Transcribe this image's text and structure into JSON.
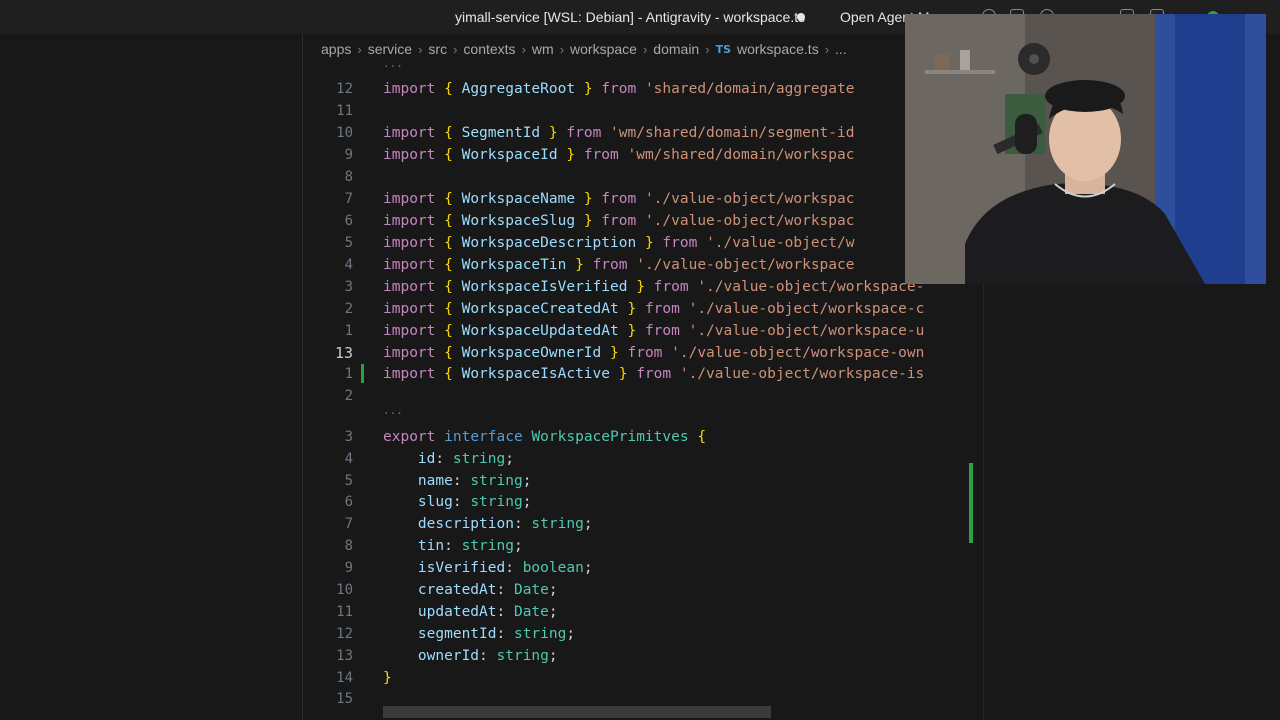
{
  "window": {
    "title": "yimall-service [WSL: Debian] - Antigravity - workspace.ts",
    "open_agent_label": "Open Agent M"
  },
  "breadcrumb": {
    "items": [
      "apps",
      "service",
      "src",
      "contexts",
      "wm",
      "workspace",
      "domain"
    ],
    "file_icon": "TS",
    "file": "workspace.ts",
    "more": "..."
  },
  "editor": {
    "fold_marker": "···",
    "line_numbers": {
      "l12": "12",
      "l11": "11",
      "l10": "10",
      "l9": "9",
      "l8": "8",
      "l7": "7",
      "l6": "6",
      "l5": "5",
      "l4": "4",
      "l3": "3",
      "l2": "2",
      "l1": "1",
      "cur": "13",
      "next": "1",
      "blank": "2",
      "i3": "3",
      "i4": "4",
      "i5": "5",
      "i6": "6",
      "i7": "7",
      "i8": "8",
      "i9": "9",
      "i10": "10",
      "i11": "11",
      "i12": "12",
      "i13": "13",
      "i14": "14",
      "i15": "15"
    },
    "imports": [
      {
        "name": "AggregateRoot",
        "path": "'shared/domain/aggregate"
      },
      {
        "name": "SegmentId",
        "path": "'wm/shared/domain/segment-id"
      },
      {
        "name": "WorkspaceId",
        "path": "'wm/shared/domain/workspac"
      },
      {
        "name": "WorkspaceName",
        "path": "'./value-object/workspac"
      },
      {
        "name": "WorkspaceSlug",
        "path": "'./value-object/workspac"
      },
      {
        "name": "WorkspaceDescription",
        "path": "'./value-object/w"
      },
      {
        "name": "WorkspaceTin",
        "path": "'./value-object/workspace"
      },
      {
        "name": "WorkspaceIsVerified",
        "path": "'./value-object/workspace-"
      },
      {
        "name": "WorkspaceCreatedAt",
        "path": "'./value-object/workspace-c"
      },
      {
        "name": "WorkspaceUpdatedAt",
        "path": "'./value-object/workspace-u"
      },
      {
        "name": "WorkspaceOwnerId",
        "path": "'./value-object/workspace-own"
      },
      {
        "name": "WorkspaceIsActive",
        "path": "'./value-object/workspace-is"
      }
    ],
    "interface": {
      "export": "export",
      "keyword": "interface",
      "name": "WorkspacePrimitves",
      "fields": [
        {
          "name": "id",
          "type": "string"
        },
        {
          "name": "name",
          "type": "string"
        },
        {
          "name": "slug",
          "type": "string"
        },
        {
          "name": "description",
          "type": "string"
        },
        {
          "name": "tin",
          "type": "string"
        },
        {
          "name": "isVerified",
          "type": "boolean"
        },
        {
          "name": "createdAt",
          "type": "Date"
        },
        {
          "name": "updatedAt",
          "type": "Date"
        },
        {
          "name": "segmentId",
          "type": "string"
        },
        {
          "name": "ownerId",
          "type": "string"
        }
      ]
    },
    "keywords": {
      "import": "import",
      "from": "from"
    }
  },
  "colors": {
    "accent_green": "#2ea043",
    "keyword": "#c586c0",
    "string": "#ce9178",
    "type": "#4ec9b0"
  }
}
